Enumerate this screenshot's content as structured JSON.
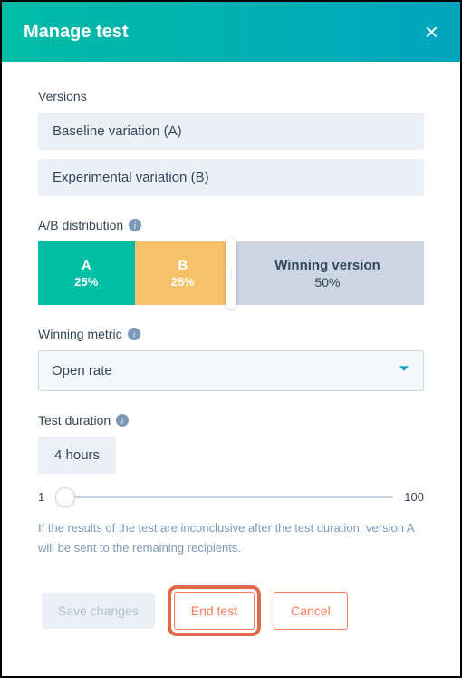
{
  "header": {
    "title": "Manage test"
  },
  "versions": {
    "label": "Versions",
    "items": [
      {
        "name": "Baseline variation (A)"
      },
      {
        "name": "Experimental variation (B)"
      }
    ]
  },
  "distribution": {
    "label": "A/B distribution",
    "a": {
      "letter": "A",
      "pct": "25%"
    },
    "b": {
      "letter": "B",
      "pct": "25%"
    },
    "winner": {
      "label": "Winning version",
      "pct": "50%"
    }
  },
  "winning_metric": {
    "label": "Winning metric",
    "value": "Open rate"
  },
  "duration": {
    "label": "Test duration",
    "value": "4 hours",
    "min": "1",
    "max": "100"
  },
  "help_text": "If the results of the test are inconclusive after the test duration, version A will be sent to the remaining recipients.",
  "buttons": {
    "save": "Save changes",
    "end": "End test",
    "cancel": "Cancel"
  }
}
